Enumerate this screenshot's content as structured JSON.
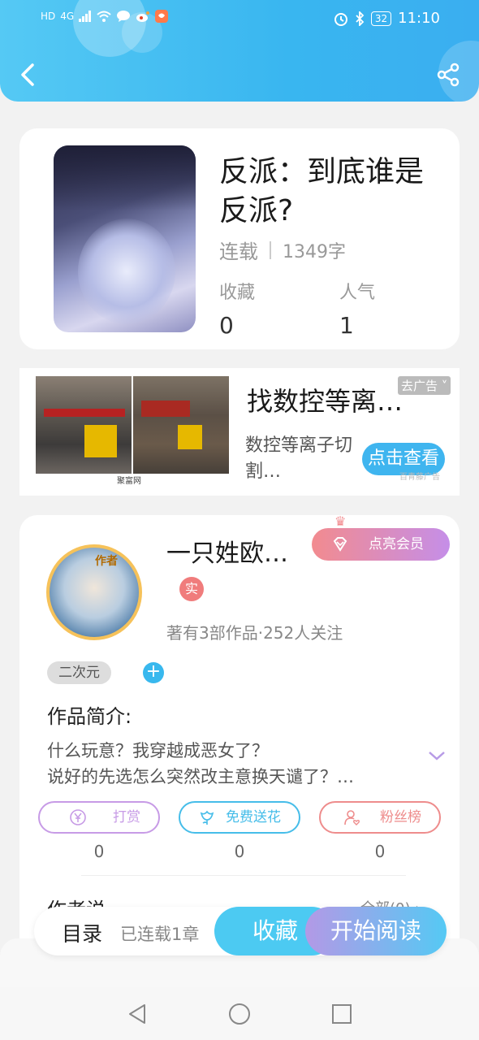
{
  "status_bar": {
    "left_icons": [
      "HD",
      "4G",
      "signal-icon",
      "wifi-icon",
      "chat-icon",
      "weibo-icon",
      "app-icon"
    ],
    "battery": "32",
    "time": "11:10"
  },
  "book": {
    "title": "反派：到底谁是反派?",
    "status": "连载",
    "word_count": "1349字",
    "stats": [
      {
        "label": "收藏",
        "value": "0"
      },
      {
        "label": "人气",
        "value": "1"
      }
    ]
  },
  "ad": {
    "title": "找数控等离…",
    "tag": "去广告",
    "desc": "数控等离子切割…",
    "button": "点击查看",
    "source": "聚富网",
    "source_right": "百青藤广告"
  },
  "author": {
    "avatar_badge": "作者",
    "name": "一只姓欧…",
    "vip_button": "点亮会员",
    "real_badge": "实",
    "meta": "著有3部作品·252人关注",
    "tag": "二次元",
    "add_tag": "+",
    "intro_heading": "作品简介:",
    "intro_line1": "什么玩意？我穿越成恶女了？",
    "intro_line2": "说好的先选怎么突然改主意换天谴了？…",
    "actions": [
      {
        "label": "打赏",
        "value": "0",
        "color": "#c79be6"
      },
      {
        "label": "免费送花",
        "value": "0",
        "color": "#46bde9"
      },
      {
        "label": "粉丝榜",
        "value": "0",
        "color": "#ee8c8c"
      }
    ],
    "author_says": "作者说",
    "all_link": "全部(0)"
  },
  "bottom_bar": {
    "toc": "目录",
    "updated": "已连载1章",
    "collect": "收藏",
    "read": "开始阅读"
  }
}
